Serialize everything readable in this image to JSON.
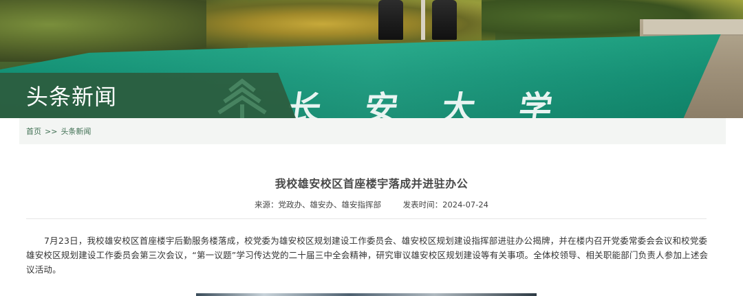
{
  "banner": {
    "section_title": "头条新闻",
    "engraved_text": [
      "长",
      "安",
      "大",
      "学"
    ]
  },
  "breadcrumb": {
    "home": "首页",
    "separator": ">>",
    "current": "头条新闻"
  },
  "article": {
    "title": "我校雄安校区首座楼宇落成并进驻办公",
    "source": "来源：党政办、雄安办、雄安指挥部",
    "date": "发表时间：2024-07-24",
    "body": "7月23日，我校雄安校区首座楼宇后勤服务楼落成，校党委为雄安校区规划建设工作委员会、雄安校区规划建设指挥部进驻办公揭牌，并在楼内召开党委常委会会议和校党委雄安校区规划建设工作委员会第三次会议，“第一议题”学习传达党的二十届三中全会精神，研究审议雄安校区规划建设等有关事项。全体校领导、相关职能部门负责人参加上述会议活动。"
  },
  "colors": {
    "banner_green": "#1ea987",
    "title_box": "#2c5c3e",
    "breadcrumb_text": "#3f6f52",
    "breadcrumb_bg": "#f3f5f3"
  }
}
